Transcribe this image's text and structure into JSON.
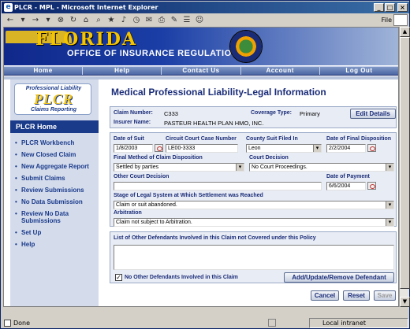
{
  "window": {
    "title": "PLCR - MPL - Microsoft Internet Explorer",
    "file_menu": "File",
    "status_text": "Done",
    "zone_text": "Local intranet"
  },
  "banner": {
    "state": "FLORIDA",
    "office": "OFFICE OF INSURANCE REGULATION"
  },
  "nav": {
    "items": [
      "Home",
      "Help",
      "Contact Us",
      "Account",
      "Log Out"
    ]
  },
  "sidebar": {
    "logo_top": "Professional Liability",
    "logo_main": "PLCR",
    "logo_bottom": "Claims Reporting",
    "heading": "PLCR Home",
    "items": [
      "PLCR Workbench",
      "New Closed Claim",
      "New Aggregate Report",
      "Submit Claims",
      "Review Submissions",
      "No Data Submission",
      "Review No Data Submissions",
      "Set Up",
      "Help"
    ]
  },
  "page": {
    "title": "Medical Professional Liability-Legal Information"
  },
  "claim": {
    "claim_number_label": "Claim Number:",
    "claim_number": "C333",
    "coverage_type_label": "Coverage Type:",
    "coverage_type": "Primary",
    "insurer_name_label": "Insurer Name:",
    "insurer_name": "PASTEUR HEALTH PLAN HMO, INC.",
    "edit_details": "Edit Details"
  },
  "form": {
    "date_of_suit_label": "Date of Suit",
    "date_of_suit": "1/8/2003",
    "circuit_case_label": "Circuit Court Case Number",
    "circuit_case": "LE00-3333",
    "county_label": "County Suit Filed In",
    "county": "Leon",
    "date_final_label": "Date of Final Disposition",
    "date_final": "2/2/2004",
    "final_method_label": "Final Method of Claim Disposition",
    "final_method": "Settled by parties",
    "court_decision_label": "Court Decision",
    "court_decision": "No Court Proceedings.",
    "other_court_label": "Other Court Decision",
    "other_court": "",
    "date_payment_label": "Date of Payment",
    "date_payment": "6/6/2004",
    "stage_label": "Stage of Legal System at Which Settlement was Reached",
    "stage": "Claim or suit abandoned.",
    "arbitration_label": "Arbitration",
    "arbitration": "Claim not subject to Arbitration."
  },
  "defendants": {
    "label": "List of Other Defendants Involved in this Claim not Covered under this Policy",
    "no_other_label": "No Other Defendants Involved in this Claim",
    "no_other_checked": true,
    "manage_button": "Add/Update/Remove Defendant"
  },
  "actions": {
    "cancel": "Cancel",
    "reset": "Reset",
    "save": "Save"
  },
  "colors": {
    "brand_navy": "#1a2c78",
    "accent_gold": "#f0c419"
  }
}
